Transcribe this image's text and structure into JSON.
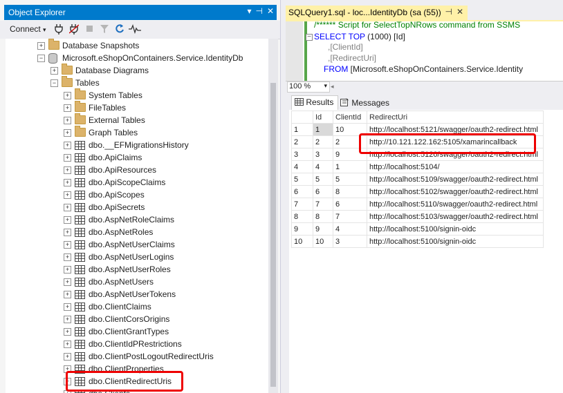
{
  "object_explorer": {
    "title": "Object Explorer",
    "title_buttons": [
      "▾",
      "⊣",
      "✕"
    ],
    "toolbar": {
      "connect_label": "Connect",
      "connect_caret": "▾",
      "icons": [
        "connect-plug-icon",
        "disconnect-plug-icon",
        "stop-icon",
        "filter-icon",
        "refresh-icon",
        "activity-monitor-icon"
      ]
    },
    "tree": [
      {
        "label": "Database Snapshots",
        "icon": "folder",
        "expander": "+"
      },
      {
        "label": "Microsoft.eShopOnContainers.Service.IdentityDb",
        "icon": "database",
        "expander": "−"
      },
      {
        "label": "Database Diagrams",
        "icon": "folder",
        "expander": "+"
      },
      {
        "label": "Tables",
        "icon": "folder",
        "expander": "−"
      },
      {
        "label": "System Tables",
        "icon": "folder",
        "expander": "+"
      },
      {
        "label": "FileTables",
        "icon": "folder",
        "expander": "+"
      },
      {
        "label": "External Tables",
        "icon": "folder",
        "expander": "+"
      },
      {
        "label": "Graph Tables",
        "icon": "folder",
        "expander": "+"
      },
      {
        "label": "dbo.__EFMigrationsHistory",
        "icon": "table",
        "expander": "+"
      },
      {
        "label": "dbo.ApiClaims",
        "icon": "table",
        "expander": "+"
      },
      {
        "label": "dbo.ApiResources",
        "icon": "table",
        "expander": "+"
      },
      {
        "label": "dbo.ApiScopeClaims",
        "icon": "table",
        "expander": "+"
      },
      {
        "label": "dbo.ApiScopes",
        "icon": "table",
        "expander": "+"
      },
      {
        "label": "dbo.ApiSecrets",
        "icon": "table",
        "expander": "+"
      },
      {
        "label": "dbo.AspNetRoleClaims",
        "icon": "table",
        "expander": "+"
      },
      {
        "label": "dbo.AspNetRoles",
        "icon": "table",
        "expander": "+"
      },
      {
        "label": "dbo.AspNetUserClaims",
        "icon": "table",
        "expander": "+"
      },
      {
        "label": "dbo.AspNetUserLogins",
        "icon": "table",
        "expander": "+"
      },
      {
        "label": "dbo.AspNetUserRoles",
        "icon": "table",
        "expander": "+"
      },
      {
        "label": "dbo.AspNetUsers",
        "icon": "table",
        "expander": "+"
      },
      {
        "label": "dbo.AspNetUserTokens",
        "icon": "table",
        "expander": "+"
      },
      {
        "label": "dbo.ClientClaims",
        "icon": "table",
        "expander": "+"
      },
      {
        "label": "dbo.ClientCorsOrigins",
        "icon": "table",
        "expander": "+"
      },
      {
        "label": "dbo.ClientGrantTypes",
        "icon": "table",
        "expander": "+"
      },
      {
        "label": "dbo.ClientIdPRestrictions",
        "icon": "table",
        "expander": "+"
      },
      {
        "label": "dbo.ClientPostLogoutRedirectUris",
        "icon": "table",
        "expander": "+"
      },
      {
        "label": "dbo.ClientProperties",
        "icon": "table",
        "expander": "+"
      },
      {
        "label": "dbo.ClientRedirectUris",
        "icon": "table",
        "expander": "+"
      },
      {
        "label": "dbo.Clients",
        "icon": "table",
        "expander": "+"
      }
    ]
  },
  "query_tab": {
    "title": "SQLQuery1.sql - loc...IdentityDb (sa (55))",
    "pin": "⊣",
    "close": "✕"
  },
  "editor": {
    "line1": "/****** Script for SelectTopNRows command from SSMS",
    "line2_kw1": "SELECT",
    "line2_kw2": "TOP",
    "line2_rest": " (1000) [Id]",
    "line3": "      ,[ClientId]",
    "line4": "      ,[RedirectUri]",
    "line5_kw": "FROM",
    "line5_rest": " [Microsoft.eShopOnContainers.Service.Identity"
  },
  "zoom": {
    "value": "100 %",
    "caret": "▾"
  },
  "results_tabs": {
    "results": "Results",
    "messages": "Messages"
  },
  "results": {
    "columns": [
      "Id",
      "ClientId",
      "RedirectUri"
    ],
    "rows": [
      [
        "1",
        "1",
        "10",
        "http://localhost:5121/swagger/oauth2-redirect.html"
      ],
      [
        "2",
        "2",
        "2",
        "http://10.121.122.162:5105/xamarincallback"
      ],
      [
        "3",
        "3",
        "9",
        "http://localhost:5120/swagger/oauth2-redirect.html"
      ],
      [
        "4",
        "4",
        "1",
        "http://localhost:5104/"
      ],
      [
        "5",
        "5",
        "5",
        "http://localhost:5109/swagger/oauth2-redirect.html"
      ],
      [
        "6",
        "6",
        "8",
        "http://localhost:5102/swagger/oauth2-redirect.html"
      ],
      [
        "7",
        "7",
        "6",
        "http://localhost:5110/swagger/oauth2-redirect.html"
      ],
      [
        "8",
        "8",
        "7",
        "http://localhost:5103/swagger/oauth2-redirect.html"
      ],
      [
        "9",
        "9",
        "4",
        "http://localhost:5100/signin-oidc"
      ],
      [
        "10",
        "10",
        "3",
        "http://localhost:5100/signin-oidc"
      ]
    ]
  },
  "colors": {
    "accent": "#007acc",
    "tab_active": "#fff1a8",
    "highlight": "#e00000",
    "keyword": "#0000ff",
    "comment": "#008000"
  }
}
